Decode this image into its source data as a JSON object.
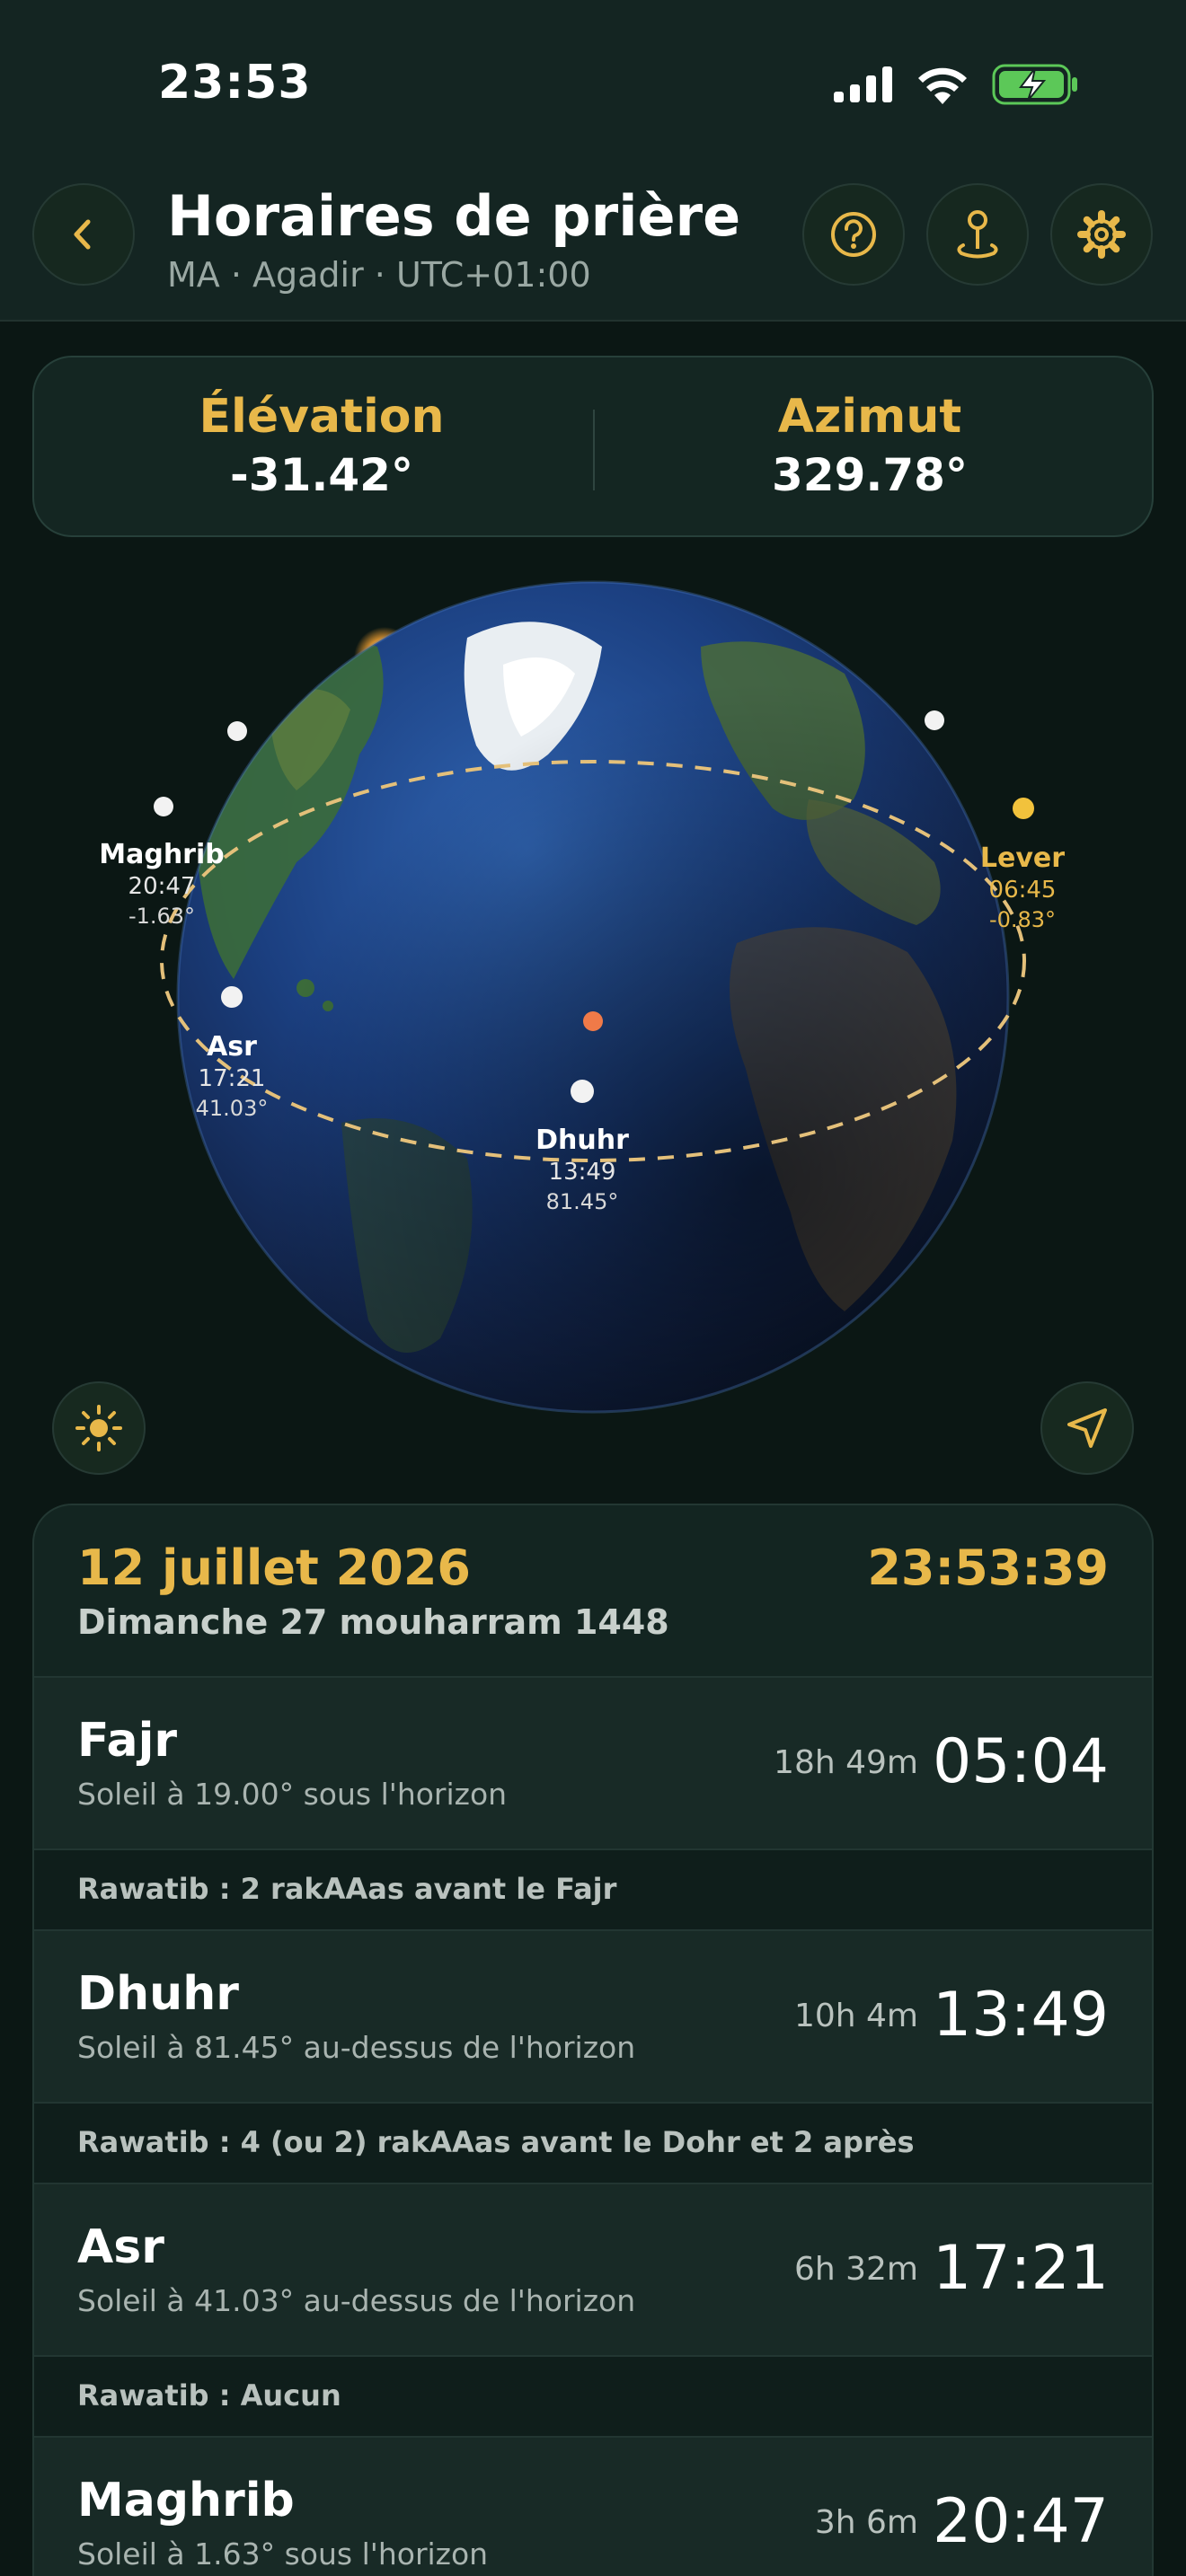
{
  "status_bar": {
    "time": "23:53",
    "icons": [
      "cellular-signal-icon",
      "wifi-icon",
      "battery-charging-icon"
    ]
  },
  "header": {
    "title": "Horaires de prière",
    "subtitle": "MA · Agadir · UTC+01:00",
    "buttons": [
      "back-icon",
      "help-icon",
      "location-pin-icon",
      "settings-icon"
    ]
  },
  "sun_position": {
    "elevation_label": "Élévation",
    "elevation_value": "-31.42°",
    "azimuth_label": "Azimut",
    "azimuth_value": "329.78°"
  },
  "globe": {
    "events": [
      {
        "name": "Maghrib",
        "time": "20:47",
        "degrees": "-1.63°"
      },
      {
        "name": "Asr",
        "time": "17:21",
        "degrees": "41.03°"
      },
      {
        "name": "Dhuhr",
        "time": "13:49",
        "degrees": "81.45°"
      },
      {
        "name": "Lever",
        "time": "06:45",
        "degrees": "-0.83°"
      }
    ],
    "buttons": [
      "sun-icon",
      "navigation-arrow-icon"
    ]
  },
  "date": {
    "gregorian": "12 juillet 2026",
    "clock": "23:53:39",
    "hijri": "Dimanche 27 mouharram 1448"
  },
  "prayers": [
    {
      "name": "Fajr",
      "description": "Soleil à 19.00° sous l'horizon",
      "remaining": "18h 49m",
      "time": "05:04",
      "rawatib": "Rawatib : 2 rakAAas avant le Fajr"
    },
    {
      "name": "Dhuhr",
      "description": "Soleil à 81.45° au-dessus de l'horizon",
      "remaining": "10h 4m",
      "time": "13:49",
      "rawatib": "Rawatib : 4 (ou 2) rakAAas avant le Dohr et 2 après"
    },
    {
      "name": "Asr",
      "description": "Soleil à 41.03° au-dessus de l'horizon",
      "remaining": "6h 32m",
      "time": "17:21",
      "rawatib": "Rawatib : Aucun"
    },
    {
      "name": "Maghrib",
      "description": "Soleil à 1.63° sous l'horizon",
      "remaining": "3h 6m",
      "time": "20:47"
    }
  ],
  "colors": {
    "accent": "#e8b84a",
    "background": "#0b1714",
    "card": "#142622",
    "battery": "#5cc858",
    "location_marker": "#f07a48"
  }
}
